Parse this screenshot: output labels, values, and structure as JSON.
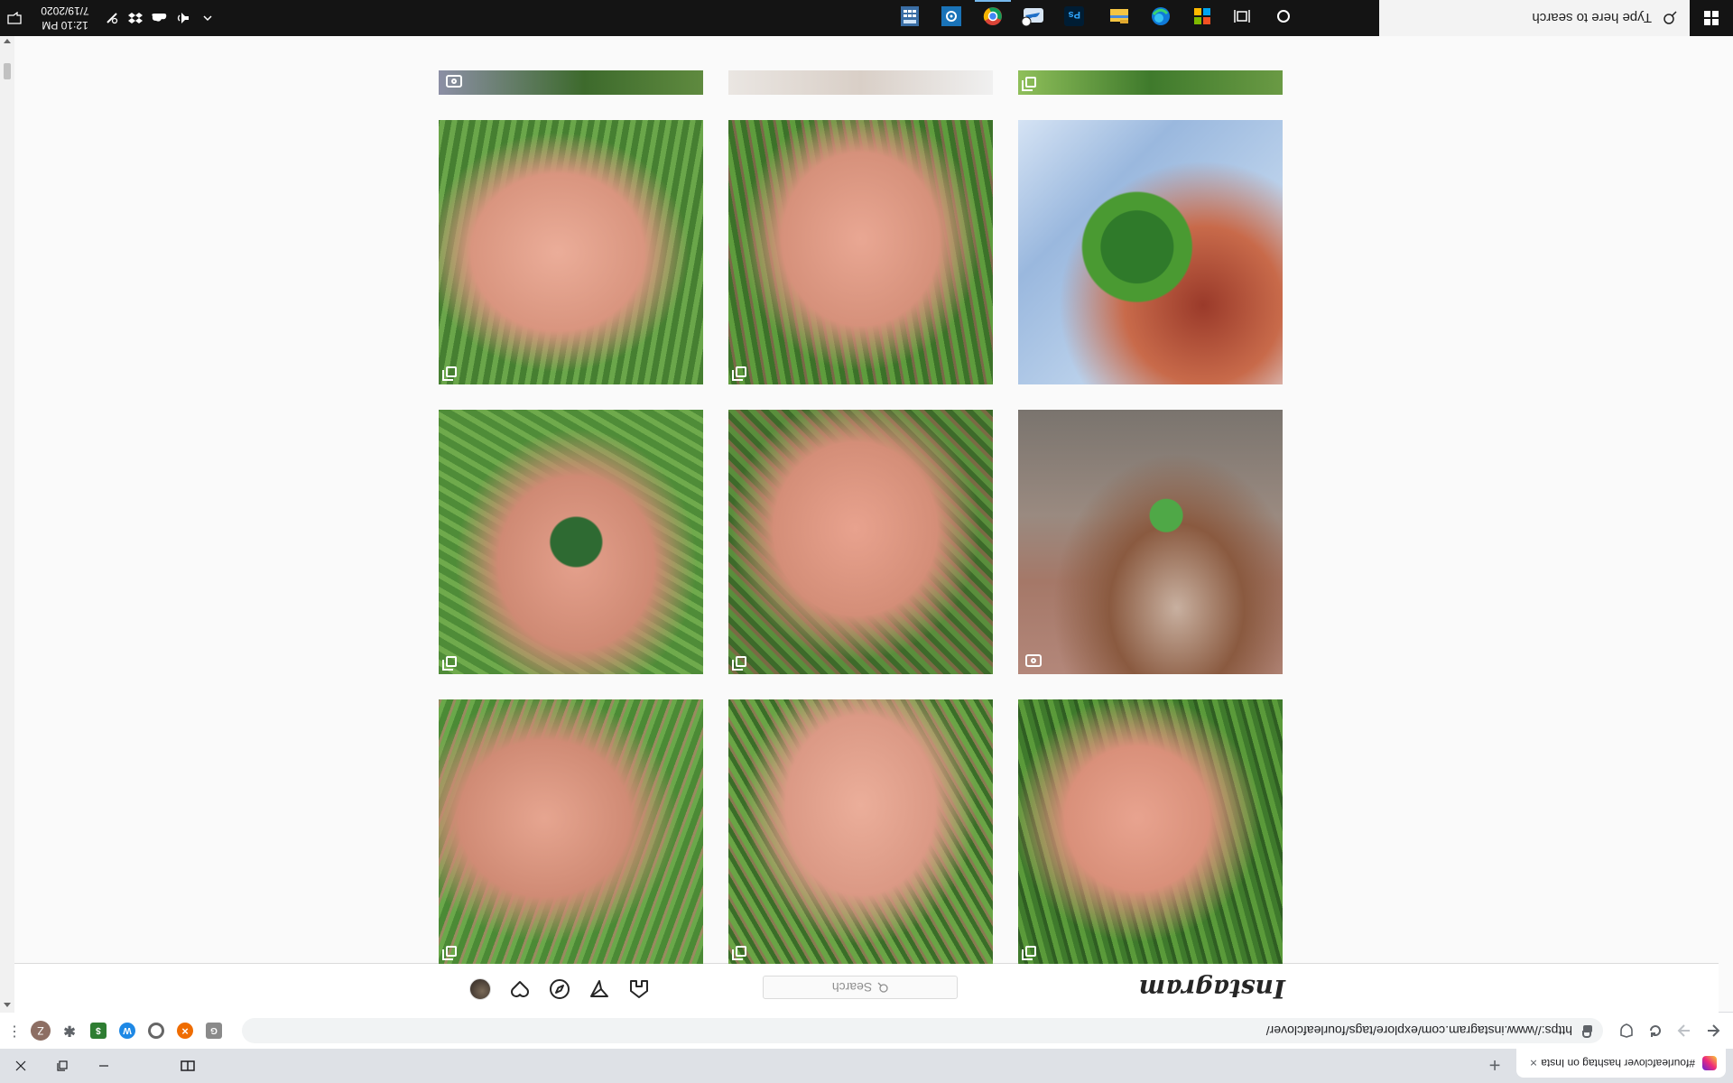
{
  "browser": {
    "tab_title": "#fourleafclover hashtag on Insta",
    "tab_close": "×",
    "new_tab": "+",
    "url": "https://www.instagram.com/explore/tags/fourleafclover/",
    "profile_initial": "Z",
    "kebab": "⋮"
  },
  "instagram": {
    "logo": "Instagram",
    "search_placeholder": "Search"
  },
  "taskbar": {
    "search_placeholder": "Type here to search",
    "time": "12:10 PM",
    "date": "7/19/2020"
  }
}
